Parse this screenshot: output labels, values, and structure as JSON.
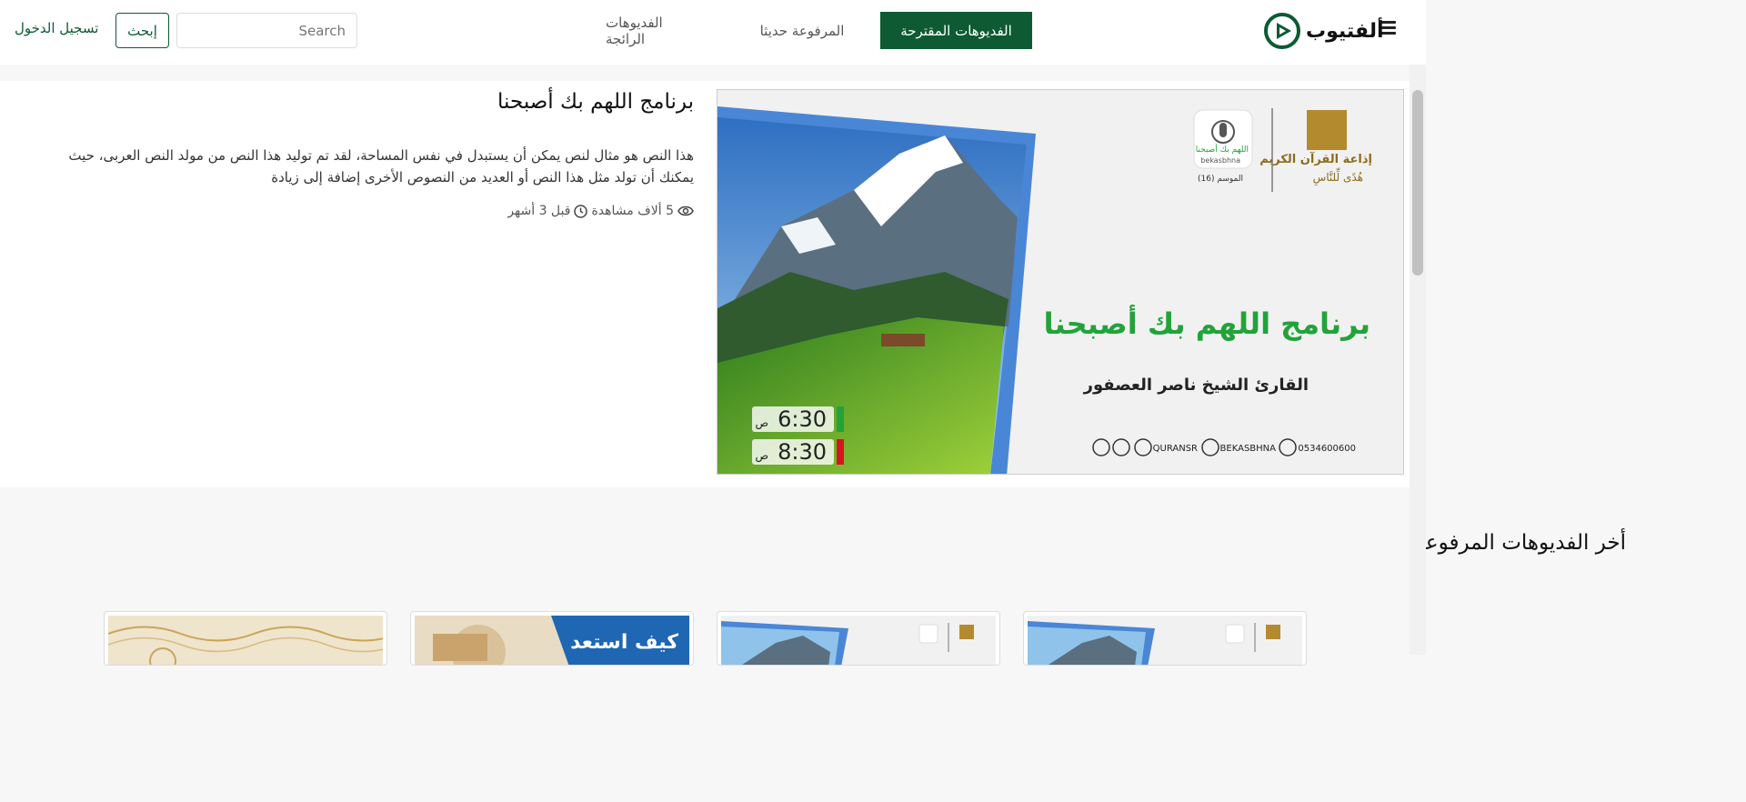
{
  "navbar": {
    "brand": "ألفتيوب",
    "links": [
      "الفديوهات المقترحة",
      "المرفوعة حديثا",
      "الفديوهات الرائجة"
    ],
    "search_placeholder": "Search",
    "search_button": "إبحث",
    "login": "تسجيل الدخول"
  },
  "hero": {
    "title": "برنامج اللهم بك أصبحنا",
    "description": "هذا النص هو مثال لنص يمكن أن يستبدل في نفس المساحة، لقد تم توليد هذا النص من مولد النص العربى، حيث يمكنك أن تولد مثل هذا النص أو العديد من النصوص الأخرى إضافة إلى زيادة",
    "views": "5 ألاف مشاهدة",
    "time": "قبل 3 أشهر",
    "image": {
      "radio_name": "إذاعة القرآن الكريم",
      "radio_tagline": "هُدًى لِّلنَّاسِ",
      "program_badge": "اللهم بك أصبحنا",
      "program_latin": "bekasbhna",
      "season": "الموسم (16)",
      "program_title": "برنامج اللهم بك أصبحنا",
      "reader": "القارئ الشيخ ناصر العصفور",
      "time1": "6:30",
      "time1_suffix": "ص",
      "time2": "8:30",
      "time2_suffix": "ص",
      "social1": "QURANSR",
      "social2": "BEKASBHNA",
      "phone": "0534600600",
      "accent_green": "#22a33a",
      "accent_red": "#d8151f"
    }
  },
  "latest": {
    "title": "أخر الفديوهات المرفوعة",
    "cards": [
      {
        "overlay": ""
      },
      {
        "overlay": ""
      },
      {
        "overlay": "كيف استعد"
      },
      {
        "overlay": ""
      }
    ]
  },
  "colors": {
    "primary": "#0d5a33"
  }
}
